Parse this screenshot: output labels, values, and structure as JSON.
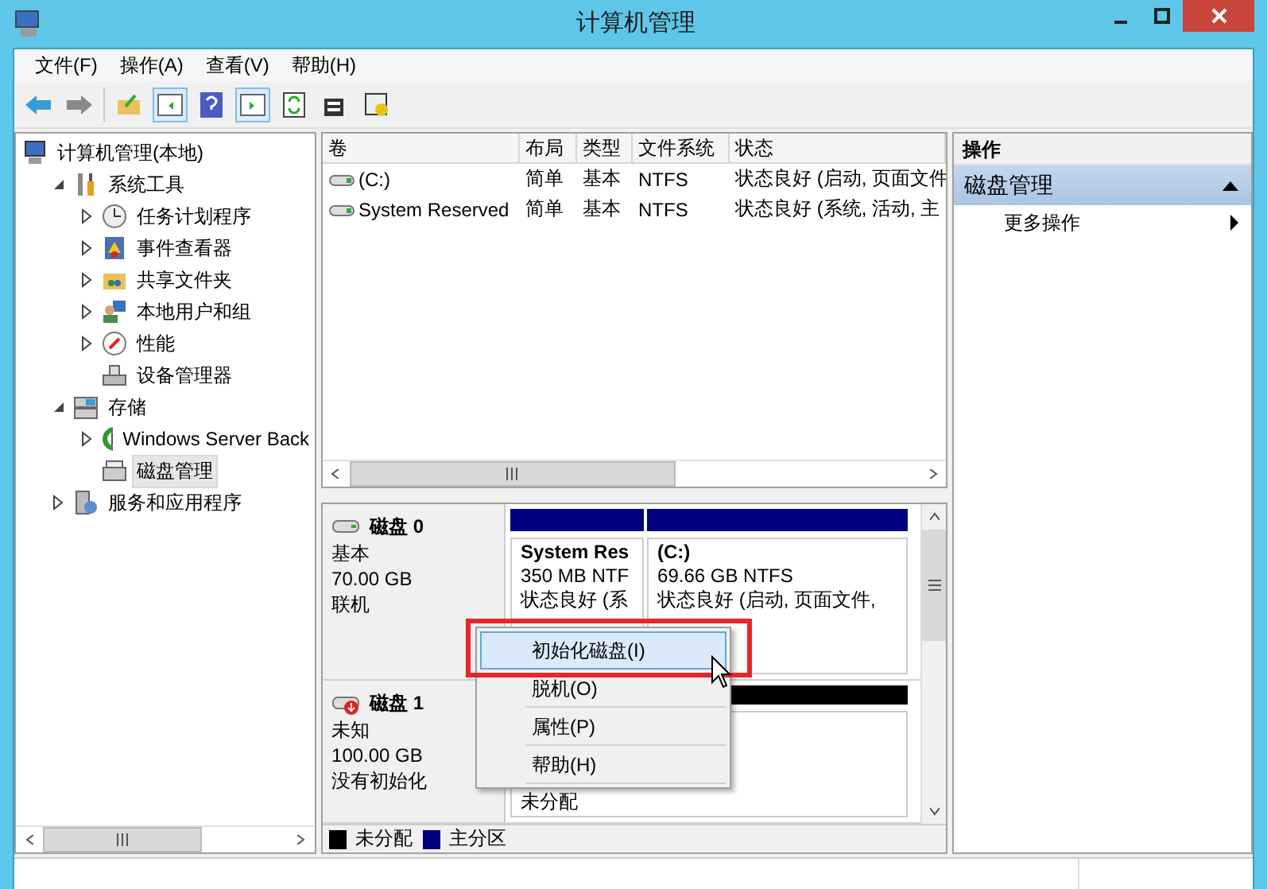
{
  "window": {
    "title": "计算机管理"
  },
  "menu": [
    "文件(F)",
    "操作(A)",
    "查看(V)",
    "帮助(H)"
  ],
  "tree": [
    {
      "label": "计算机管理(本地)",
      "selected": false,
      "children": [
        {
          "label": "系统工具",
          "expanded": true,
          "selected": false,
          "children": [
            {
              "label": "任务计划程序",
              "expanded": false,
              "selected": false
            },
            {
              "label": "事件查看器",
              "expanded": false,
              "selected": false
            },
            {
              "label": "共享文件夹",
              "expanded": false,
              "selected": false
            },
            {
              "label": "本地用户和组",
              "expanded": false,
              "selected": false
            },
            {
              "label": "性能",
              "expanded": false,
              "selected": false
            },
            {
              "label": "设备管理器",
              "selected": false
            }
          ]
        },
        {
          "label": "存储",
          "expanded": true,
          "selected": false,
          "children": [
            {
              "label": "Windows Server Back",
              "expanded": false,
              "selected": false
            },
            {
              "label": "磁盘管理",
              "selected": true
            }
          ]
        },
        {
          "label": "服务和应用程序",
          "expanded": false,
          "selected": false
        }
      ]
    }
  ],
  "volumes": {
    "columns": [
      "卷",
      "布局",
      "类型",
      "文件系统",
      "状态"
    ],
    "rows": [
      [
        "(C:)",
        "简单",
        "基本",
        "NTFS",
        "状态良好 (启动, 页面文件"
      ],
      [
        "System Reserved",
        "简单",
        "基本",
        "NTFS",
        "状态良好 (系统, 活动, 主"
      ]
    ]
  },
  "disks": [
    {
      "name": "磁盘 0",
      "warning": false,
      "type": "基本",
      "size": "70.00 GB",
      "status": "联机",
      "partitions": [
        {
          "name": "System Res",
          "detail": "350 MB NTF",
          "status": "状态良好 (系",
          "color": "#000080"
        },
        {
          "name": "(C:)",
          "detail": "69.66 GB NTFS",
          "status": "状态良好 (启动, 页面文件,",
          "color": "#000080"
        }
      ]
    },
    {
      "name": "磁盘 1",
      "warning": true,
      "type": "未知",
      "size": "100.00 GB",
      "status": "没有初始化",
      "partitions": [
        {
          "status": "未分配",
          "color": "#000000"
        }
      ]
    }
  ],
  "legend": [
    {
      "label": "未分配",
      "color": "#000000"
    },
    {
      "label": "主分区",
      "color": "#000080"
    }
  ],
  "context_menu": [
    {
      "label": "初始化磁盘(I)",
      "selected": true
    },
    {
      "label": "脱机(O)",
      "selected": false
    },
    {
      "label": "属性(P)",
      "selected": false
    },
    {
      "label": "帮助(H)",
      "selected": false
    }
  ],
  "actions": {
    "header": "操作",
    "section": {
      "title": "磁盘管理",
      "expanded": true
    },
    "items": [
      "更多操作"
    ]
  }
}
